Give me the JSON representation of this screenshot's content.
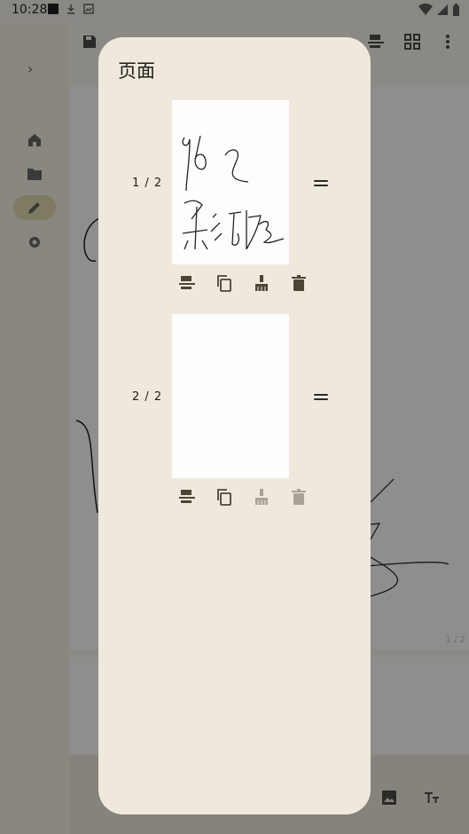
{
  "status_bar": {
    "time": "10:28"
  },
  "sheet": {
    "title": "页面",
    "pages": [
      {
        "label": "1 / 2",
        "has_content": true,
        "clear_enabled": true,
        "delete_enabled": true
      },
      {
        "label": "2 / 2",
        "has_content": false,
        "clear_enabled": false,
        "delete_enabled": false
      }
    ]
  },
  "background": {
    "page_indicator": "1 / 2",
    "rail_items": [
      "home-icon",
      "folder-icon",
      "edit-icon",
      "settings-icon"
    ]
  },
  "colors": {
    "sheet_bg": "#efe9dd",
    "icon": "#4a4535",
    "icon_disabled": "#a8a396",
    "scrim": "#8a8883"
  }
}
